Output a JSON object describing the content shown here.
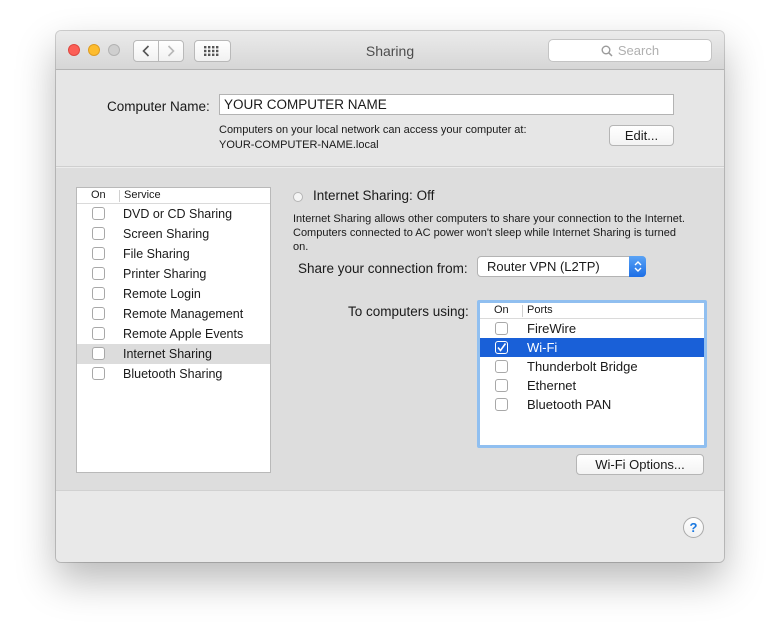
{
  "window": {
    "title": "Sharing"
  },
  "toolbar": {
    "search_placeholder": "Search"
  },
  "computer_name": {
    "label": "Computer Name:",
    "value": "YOUR COMPUTER NAME",
    "desc_line1": "Computers on your local network can access your computer at:",
    "desc_line2": "YOUR-COMPUTER-NAME.local",
    "edit_label": "Edit..."
  },
  "services": {
    "header_on": "On",
    "header_service": "Service",
    "items": [
      {
        "label": "DVD or CD Sharing",
        "checked": false
      },
      {
        "label": "Screen Sharing",
        "checked": false
      },
      {
        "label": "File Sharing",
        "checked": false
      },
      {
        "label": "Printer Sharing",
        "checked": false
      },
      {
        "label": "Remote Login",
        "checked": false
      },
      {
        "label": "Remote Management",
        "checked": false
      },
      {
        "label": "Remote Apple Events",
        "checked": false
      },
      {
        "label": "Internet Sharing",
        "checked": false,
        "selected": true
      },
      {
        "label": "Bluetooth Sharing",
        "checked": false
      }
    ]
  },
  "internet_sharing": {
    "status": "Internet Sharing: Off",
    "description": "Internet Sharing allows other computers to share your connection to the Internet. Computers connected to AC power won't sleep while Internet Sharing is turned on.",
    "share_from_label": "Share your connection from:",
    "share_from_value": "Router VPN (L2TP)",
    "to_label": "To computers using:"
  },
  "ports": {
    "header_on": "On",
    "header_ports": "Ports",
    "items": [
      {
        "label": "FireWire",
        "checked": false
      },
      {
        "label": "Wi-Fi",
        "checked": true,
        "selected": true
      },
      {
        "label": "Thunderbolt Bridge",
        "checked": false
      },
      {
        "label": "Ethernet",
        "checked": false
      },
      {
        "label": "Bluetooth PAN",
        "checked": false
      }
    ]
  },
  "buttons": {
    "wifi_options": "Wi-Fi Options...",
    "help": "?"
  },
  "colors": {
    "selection": "#1960d8",
    "focus_ring": "#90bff0",
    "accent": "#1c6ee6"
  }
}
